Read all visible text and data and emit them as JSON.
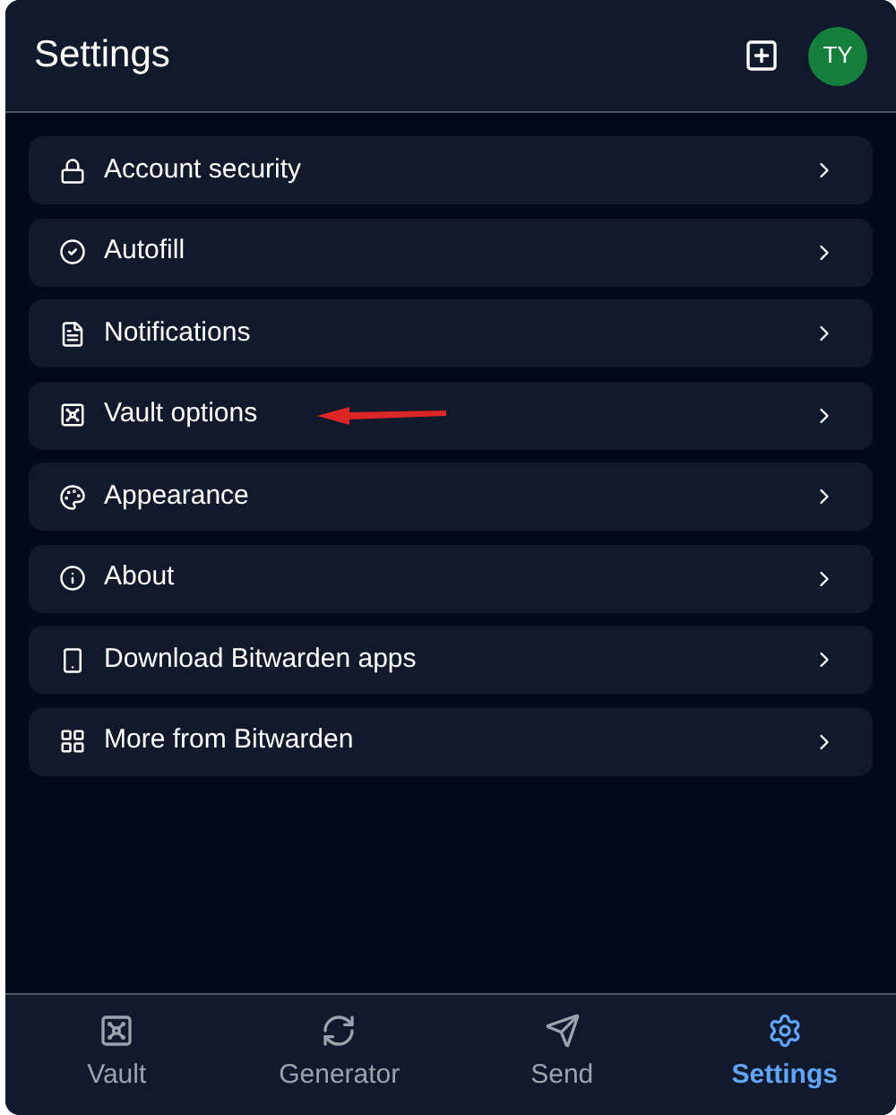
{
  "header": {
    "title": "Settings",
    "avatar": "TY"
  },
  "items": [
    {
      "label": "Account security"
    },
    {
      "label": "Autofill"
    },
    {
      "label": "Notifications"
    },
    {
      "label": "Vault options"
    },
    {
      "label": "Appearance"
    },
    {
      "label": "About"
    },
    {
      "label": "Download Bitwarden apps"
    },
    {
      "label": "More from Bitwarden"
    }
  ],
  "nav": [
    {
      "label": "Vault",
      "selected": false
    },
    {
      "label": "Generator",
      "selected": false
    },
    {
      "label": "Send",
      "selected": false
    },
    {
      "label": "Settings",
      "selected": true
    }
  ]
}
